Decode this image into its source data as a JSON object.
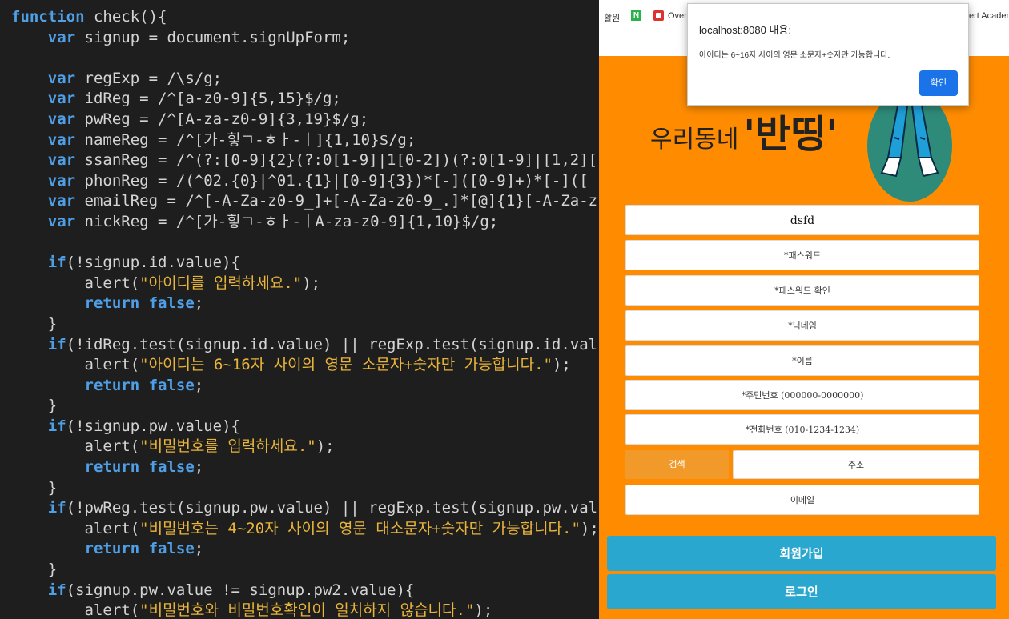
{
  "editor": {
    "lines": [
      [
        {
          "t": "function",
          "k": "kw"
        },
        {
          "t": " check(){"
        }
      ],
      [
        {
          "t": "    "
        },
        {
          "t": "var",
          "k": "kw"
        },
        {
          "t": " signup = document.signUpForm;"
        }
      ],
      [
        {
          "t": ""
        }
      ],
      [
        {
          "t": "    "
        },
        {
          "t": "var",
          "k": "kw"
        },
        {
          "t": " regExp = /\\s/g;"
        }
      ],
      [
        {
          "t": "    "
        },
        {
          "t": "var",
          "k": "kw"
        },
        {
          "t": " idReg = /^[a-z0-9]{5,15}$/g;"
        }
      ],
      [
        {
          "t": "    "
        },
        {
          "t": "var",
          "k": "kw"
        },
        {
          "t": " pwReg = /^[A-za-z0-9]{3,19}$/g;"
        }
      ],
      [
        {
          "t": "    "
        },
        {
          "t": "var",
          "k": "kw"
        },
        {
          "t": " nameReg = /^[가-힣ㄱ-ㅎㅏ-ㅣ]{1,10}$/g;"
        }
      ],
      [
        {
          "t": "    "
        },
        {
          "t": "var",
          "k": "kw"
        },
        {
          "t": " ssanReg = /^(?:[0-9]{2}(?:0[1-9]|1[0-2])(?:0[1-9]|[1,2]["
        }
      ],
      [
        {
          "t": "    "
        },
        {
          "t": "var",
          "k": "kw"
        },
        {
          "t": " phonReg = /(^02.{0}|^01.{1}|[0-9]{3})*[-]([0-9]+)*[-](["
        }
      ],
      [
        {
          "t": "    "
        },
        {
          "t": "var",
          "k": "kw"
        },
        {
          "t": " emailReg = /^[-A-Za-z0-9_]+[-A-Za-z0-9_.]*[@]{1}[-A-Za-z"
        }
      ],
      [
        {
          "t": "    "
        },
        {
          "t": "var",
          "k": "kw"
        },
        {
          "t": " nickReg = /^[가-힣ㄱ-ㅎㅏ-ㅣA-za-z0-9]{1,10}$/g;"
        }
      ],
      [
        {
          "t": ""
        }
      ],
      [
        {
          "t": "    "
        },
        {
          "t": "if",
          "k": "kw"
        },
        {
          "t": "(!signup.id.value){"
        }
      ],
      [
        {
          "t": "        alert("
        },
        {
          "t": "\"아이디를 입력하세요.\"",
          "k": "str"
        },
        {
          "t": ");"
        }
      ],
      [
        {
          "t": "        "
        },
        {
          "t": "return false",
          "k": "kw"
        },
        {
          "t": ";"
        }
      ],
      [
        {
          "t": "    }"
        }
      ],
      [
        {
          "t": "    "
        },
        {
          "t": "if",
          "k": "kw"
        },
        {
          "t": "(!idReg.test(signup.id.value) || regExp.test(signup.id.val"
        }
      ],
      [
        {
          "t": "        alert("
        },
        {
          "t": "\"아이디는 6~16자 사이의 영문 소문자+숫자만 가능합니다.\"",
          "k": "str"
        },
        {
          "t": ");"
        }
      ],
      [
        {
          "t": "        "
        },
        {
          "t": "return false",
          "k": "kw"
        },
        {
          "t": ";"
        }
      ],
      [
        {
          "t": "    }"
        }
      ],
      [
        {
          "t": "    "
        },
        {
          "t": "if",
          "k": "kw"
        },
        {
          "t": "(!signup.pw.value){"
        }
      ],
      [
        {
          "t": "        alert("
        },
        {
          "t": "\"비밀번호를 입력하세요.\"",
          "k": "str"
        },
        {
          "t": ");"
        }
      ],
      [
        {
          "t": "        "
        },
        {
          "t": "return false",
          "k": "kw"
        },
        {
          "t": ";"
        }
      ],
      [
        {
          "t": "    }"
        }
      ],
      [
        {
          "t": "    "
        },
        {
          "t": "if",
          "k": "kw"
        },
        {
          "t": "(!pwReg.test(signup.pw.value) || regExp.test(signup.pw.val"
        }
      ],
      [
        {
          "t": "        alert("
        },
        {
          "t": "\"비밀번호는 4~20자 사이의 영문 대소문자+숫자만 가능합니다.\"",
          "k": "str"
        },
        {
          "t": ");"
        }
      ],
      [
        {
          "t": "        "
        },
        {
          "t": "return false",
          "k": "kw"
        },
        {
          "t": ";"
        }
      ],
      [
        {
          "t": "    }"
        }
      ],
      [
        {
          "t": "    "
        },
        {
          "t": "if",
          "k": "kw"
        },
        {
          "t": "(signup.pw.value != signup.pw2.value){"
        }
      ],
      [
        {
          "t": "        alert("
        },
        {
          "t": "\"비밀번호와 비밀번호확인이 일치하지 않습니다.\"",
          "k": "str"
        },
        {
          "t": ");"
        }
      ]
    ]
  },
  "bookmarks": {
    "left_fragment": "활원",
    "n_icon": "N",
    "overview": "Overview",
    "right_fragment": "ert Academy"
  },
  "alert": {
    "title": "localhost:8080 내용:",
    "message": "아이디는 6~16자 사이의 영문 소문자+숫자만 가능합니다.",
    "ok_label": "확인"
  },
  "logo": {
    "prefix": "우리동네",
    "main": "'반띵'"
  },
  "form": {
    "id_value": "dsfd",
    "password_placeholder": "*패스워드",
    "password_confirm_placeholder": "*패스워드 확인",
    "nickname_placeholder": "*닉네임",
    "name_placeholder": "*이름",
    "ssn_placeholder": "*주민번호 (000000-0000000)",
    "phone_placeholder": "*전화번호 (010-1234-1234)",
    "search_label": "검색",
    "address_placeholder": "주소",
    "email_placeholder": "이메일",
    "signup_label": "회원가입",
    "login_label": "로그인"
  },
  "colors": {
    "page_background": "#ff8c00",
    "button_blue": "#2aa7cf",
    "search_orange": "#f19a2a",
    "keyword": "#4f9fe6",
    "string": "#e8b43a"
  }
}
